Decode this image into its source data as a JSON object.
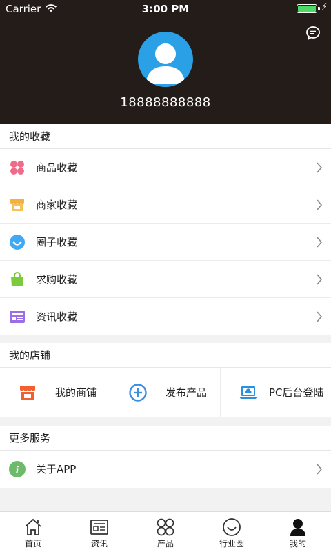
{
  "status_bar": {
    "carrier": "Carrier",
    "time": "3:00 PM"
  },
  "profile": {
    "phone": "18888888888"
  },
  "favorites": {
    "title": "我的收藏",
    "items": [
      {
        "label": "商品收藏",
        "icon": "flower-icon",
        "color": "#f06a8a"
      },
      {
        "label": "商家收藏",
        "icon": "store-icon",
        "color": "#f5b13d"
      },
      {
        "label": "圈子收藏",
        "icon": "circle-smile-icon",
        "color": "#3fa9f5"
      },
      {
        "label": "求购收藏",
        "icon": "shopping-bag-icon",
        "color": "#7ccb3c"
      },
      {
        "label": "资讯收藏",
        "icon": "news-card-icon",
        "color": "#9b6ee8"
      }
    ]
  },
  "shop": {
    "title": "我的店铺",
    "items": [
      {
        "label": "我的商铺",
        "icon": "shop-awning-icon",
        "color": "#f06030"
      },
      {
        "label": "发布产品",
        "icon": "plus-circle-icon",
        "color": "#3a8ee6"
      },
      {
        "label": "PC后台登陆",
        "icon": "laptop-cloud-icon",
        "color": "#2a90e0"
      }
    ]
  },
  "more": {
    "title": "更多服务",
    "items": [
      {
        "label": "关于APP",
        "icon": "info-icon",
        "color": "#6dbb6a"
      }
    ]
  },
  "tabs": [
    {
      "label": "首页",
      "icon": "home-icon"
    },
    {
      "label": "资讯",
      "icon": "news-icon"
    },
    {
      "label": "产品",
      "icon": "grid-petals-icon"
    },
    {
      "label": "行业圈",
      "icon": "smile-icon"
    },
    {
      "label": "我的",
      "icon": "person-icon",
      "active": true
    }
  ]
}
